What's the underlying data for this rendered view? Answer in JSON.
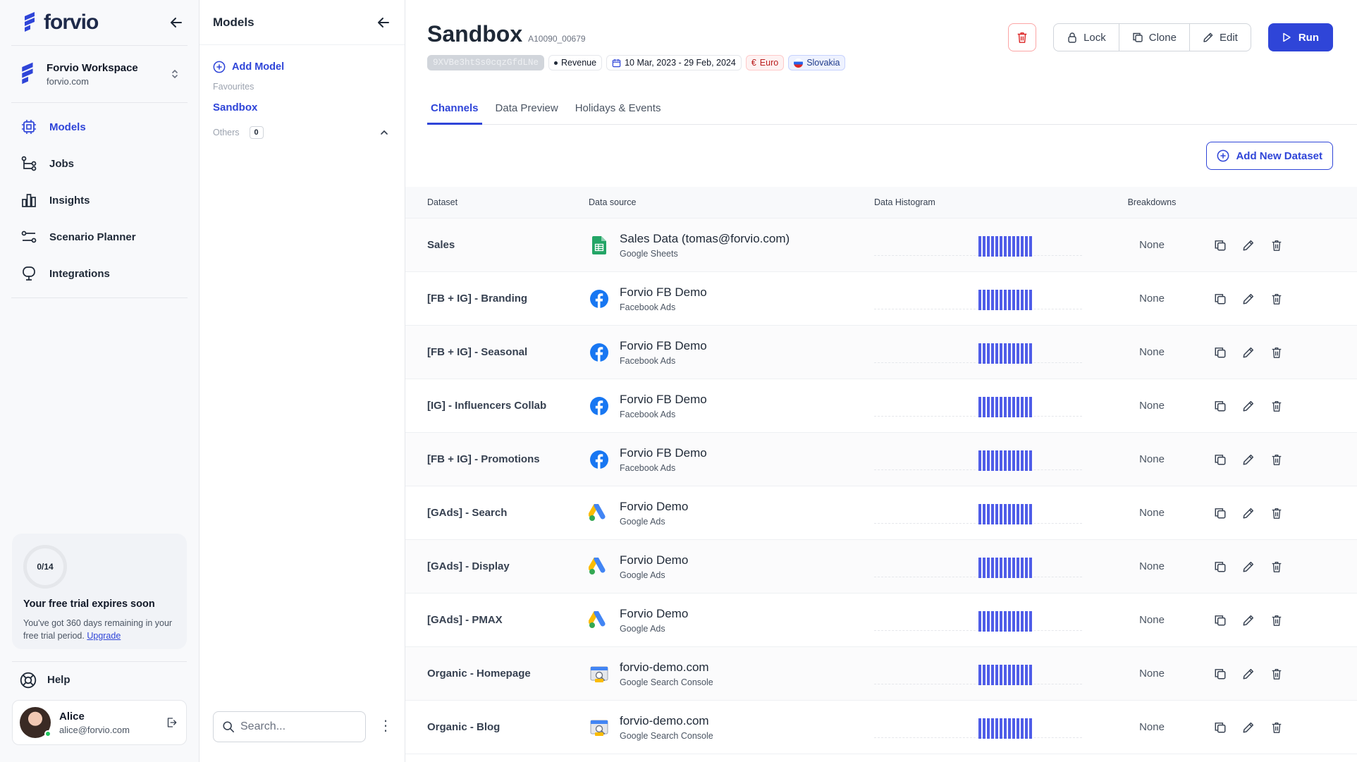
{
  "brand": {
    "name": "forvio"
  },
  "workspace": {
    "name": "Forvio Workspace",
    "domain": "forvio.com"
  },
  "nav": [
    {
      "label": "Models",
      "icon": "models-icon",
      "active": true
    },
    {
      "label": "Jobs",
      "icon": "jobs-icon",
      "active": false
    },
    {
      "label": "Insights",
      "icon": "insights-icon",
      "active": false
    },
    {
      "label": "Scenario Planner",
      "icon": "scenario-planner-icon",
      "active": false
    },
    {
      "label": "Integrations",
      "icon": "integrations-icon",
      "active": false
    }
  ],
  "trial": {
    "progress": "0/14",
    "title": "Your free trial expires soon",
    "text": "You've got 360 days remaining in your free trial period.",
    "link": "Upgrade"
  },
  "help": {
    "label": "Help"
  },
  "user": {
    "name": "Alice",
    "email": "alice@forvio.com"
  },
  "models_panel": {
    "title": "Models",
    "add_label": "Add Model",
    "favourites_label": "Favourites",
    "favourites": [
      "Sandbox"
    ],
    "others_label": "Others",
    "others_count": "0",
    "search_placeholder": "Search..."
  },
  "model": {
    "title": "Sandbox",
    "id": "A10090_00679",
    "hash": "9XVBe3htSs0cqzGfdLNe",
    "target": "Revenue",
    "date_range": "10 Mar, 2023 - 29 Feb, 2024",
    "currency": "Euro",
    "country": "Slovakia"
  },
  "actions": {
    "lock": "Lock",
    "clone": "Clone",
    "edit": "Edit",
    "run": "Run"
  },
  "tabs": [
    "Channels",
    "Data Preview",
    "Holidays & Events"
  ],
  "add_dataset_label": "Add New Dataset",
  "table": {
    "headers": [
      "Dataset",
      "Data source",
      "Data Histogram",
      "Breakdowns"
    ],
    "rows": [
      {
        "dataset": "Sales",
        "source": "Sales Data (tomas@forvio.com)",
        "source_type": "Google Sheets",
        "icon": "google-sheets-icon",
        "breakdowns": "None"
      },
      {
        "dataset": "[FB + IG] - Branding",
        "source": "Forvio FB Demo",
        "source_type": "Facebook Ads",
        "icon": "facebook-icon",
        "breakdowns": "None"
      },
      {
        "dataset": "[FB + IG] - Seasonal",
        "source": "Forvio FB Demo",
        "source_type": "Facebook Ads",
        "icon": "facebook-icon",
        "breakdowns": "None"
      },
      {
        "dataset": "[IG] - Influencers Collab",
        "source": "Forvio FB Demo",
        "source_type": "Facebook Ads",
        "icon": "facebook-icon",
        "breakdowns": "None"
      },
      {
        "dataset": "[FB + IG] - Promotions",
        "source": "Forvio FB Demo",
        "source_type": "Facebook Ads",
        "icon": "facebook-icon",
        "breakdowns": "None"
      },
      {
        "dataset": "[GAds] - Search",
        "source": "Forvio Demo",
        "source_type": "Google Ads",
        "icon": "google-ads-icon",
        "breakdowns": "None"
      },
      {
        "dataset": "[GAds] - Display",
        "source": "Forvio Demo",
        "source_type": "Google Ads",
        "icon": "google-ads-icon",
        "breakdowns": "None"
      },
      {
        "dataset": "[GAds] - PMAX",
        "source": "Forvio Demo",
        "source_type": "Google Ads",
        "icon": "google-ads-icon",
        "breakdowns": "None"
      },
      {
        "dataset": "Organic - Homepage",
        "source": "forvio-demo.com",
        "source_type": "Google Search Console",
        "icon": "google-search-console-icon",
        "breakdowns": "None"
      },
      {
        "dataset": "Organic - Blog",
        "source": "forvio-demo.com",
        "source_type": "Google Search Console",
        "icon": "google-search-console-icon",
        "breakdowns": "None"
      }
    ]
  },
  "colors": {
    "accent": "#2f45d8",
    "histogram": "#4f5de8",
    "danger": "#dc2626"
  }
}
